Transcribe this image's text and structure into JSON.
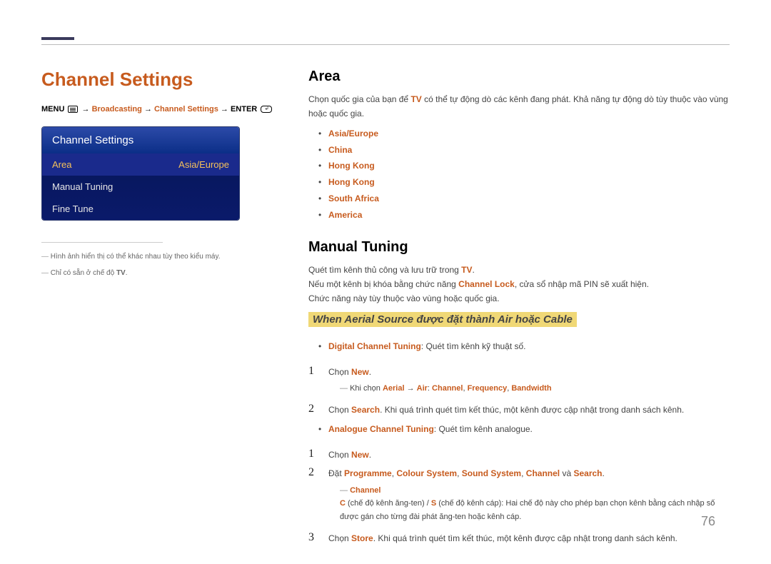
{
  "page_number": "76",
  "left": {
    "title": "Channel Settings",
    "breadcrumb": {
      "menu_label": "MENU",
      "path_1": "Broadcasting",
      "path_2": "Channel Settings",
      "enter_label": "ENTER"
    },
    "osd": {
      "header": "Channel Settings",
      "rows": [
        {
          "label": "Area",
          "value": "Asia/Europe",
          "selected": true
        },
        {
          "label": "Manual Tuning",
          "value": "",
          "selected": false
        },
        {
          "label": "Fine Tune",
          "value": "",
          "selected": false
        }
      ]
    },
    "notes": [
      "Hình ảnh hiển thị có thể khác nhau tùy theo kiểu máy.",
      "Chỉ có sẵn ở chế độ TV."
    ],
    "note_hl_word": "TV"
  },
  "area": {
    "heading": "Area",
    "intro_1": "Chọn quốc gia của bạn để ",
    "intro_hl": "TV",
    "intro_2": " có thể tự động dò các kênh đang phát. Khả năng tự động dò tùy thuộc vào vùng hoặc quốc gia.",
    "options": [
      "Asia/Europe",
      "China",
      "Hong Kong",
      "Hong Kong",
      "South Africa",
      "America"
    ]
  },
  "manual": {
    "heading": "Manual Tuning",
    "p1_a": "Quét tìm kênh thủ công và lưu trữ trong ",
    "p1_hl": "TV",
    "p1_b": ".",
    "p2_a": "Nếu một kênh bị khóa bằng chức năng ",
    "p2_hl": "Channel Lock",
    "p2_b": ", cửa sổ nhập mã PIN sẽ xuất hiện.",
    "p3": "Chức năng này tùy thuộc vào vùng hoặc quốc gia.",
    "sub_heading": "When Aerial Source được đặt thành Air hoặc Cable",
    "digital_label": "Digital Channel Tuning",
    "digital_desc": ": Quét tìm kênh kỹ thuật số.",
    "step1_a": "Chọn ",
    "step1_hl": "New",
    "step1_b": ".",
    "sub1_a": "Khi chọn ",
    "sub1_parts": {
      "aerial": "Aerial",
      "arrow": " → ",
      "air": "Air",
      "colon": ": ",
      "channel": "Channel",
      "sep1": ", ",
      "frequency": "Frequency",
      "sep2": ", ",
      "bandwidth": "Bandwidth"
    },
    "step2_a": "Chọn ",
    "step2_hl": "Search",
    "step2_b": ". Khi quá trình quét tìm kết thúc, một kênh được cập nhật trong danh sách kênh.",
    "analogue_label": "Analogue Channel Tuning",
    "analogue_desc": ": Quét tìm kênh analogue.",
    "a_step1_a": "Chọn ",
    "a_step1_hl": "New",
    "a_step1_b": ".",
    "a_step2_a": "Đặt ",
    "a_step2_parts": {
      "programme": "Programme",
      "s1": ", ",
      "colour": "Colour System",
      "s2": ", ",
      "sound": "Sound System",
      "s3": ", ",
      "channel": "Channel",
      "and": " và ",
      "search": "Search"
    },
    "a_step2_b": ".",
    "channel_note_label": "Channel",
    "channel_note_a": "C",
    "channel_note_body_a": " (chế độ kênh ăng-ten) / ",
    "channel_note_s": "S",
    "channel_note_body_b": " (chế độ kênh cáp): Hai chế độ này cho phép bạn chọn kênh bằng cách nhập số được gán cho từng đài phát ăng-ten hoặc kênh cáp.",
    "a_step3_a": "Chọn ",
    "a_step3_hl": "Store",
    "a_step3_b": ". Khi quá trình quét tìm kết thúc, một kênh được cập nhật trong danh sách kênh."
  }
}
